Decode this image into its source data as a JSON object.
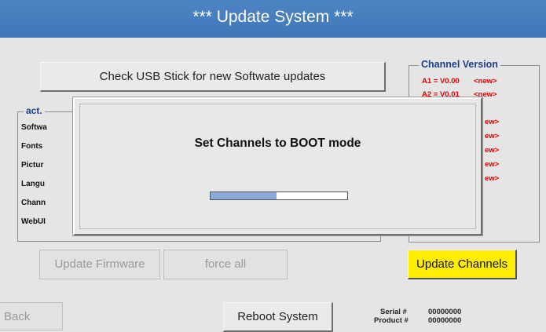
{
  "title": "*** Update System ***",
  "buttons": {
    "check_usb": "Check USB Stick for new Softwate updates",
    "update_firmware": "Update Firmware",
    "force_all": "force all",
    "update_channels": "Update Channels",
    "back": "Back",
    "reboot": "Reboot System"
  },
  "act_group": {
    "title": "act.",
    "rows": [
      "Softwa",
      "Fonts",
      "Pictur",
      "Langu",
      "Chann",
      "WebUI"
    ]
  },
  "channel_version": {
    "title": "Channel Version",
    "rows": [
      {
        "label": "A1 = V0.00",
        "status": "<new>"
      },
      {
        "label": "A2 = V0.01",
        "status": "<new>"
      }
    ],
    "partial_rows": [
      "ew>",
      "ew>",
      "ew>",
      "ew>",
      "ew>"
    ]
  },
  "dialog": {
    "message": "Set Channels to BOOT mode",
    "progress": 0.48
  },
  "footer": {
    "serial_label": "Serial #",
    "serial_value": "00000000",
    "product_label": "Product #",
    "product_value": "00000000"
  },
  "colors": {
    "titlebar": "#4279bc",
    "accent_yellow": "#ffec00",
    "channel_text": "#e00000",
    "group_title": "#1d3f8a",
    "progress_fill": "#8aa8d8"
  }
}
